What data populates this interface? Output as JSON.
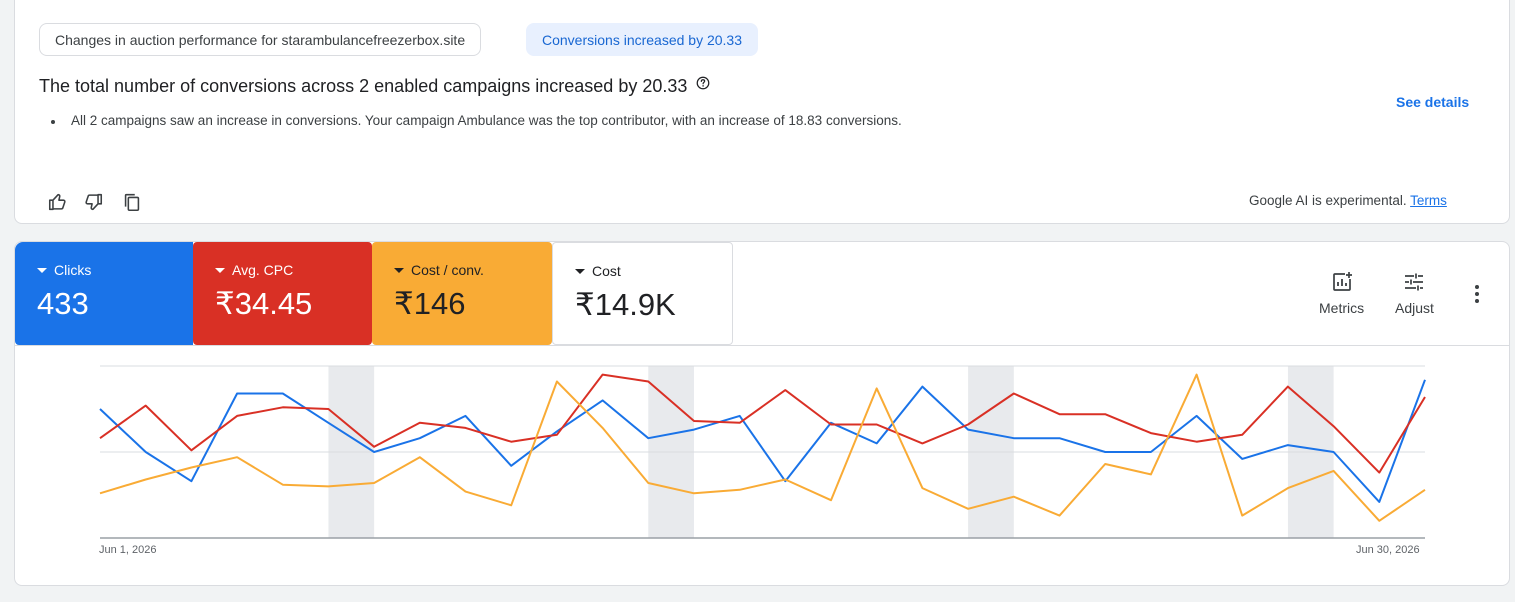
{
  "insight": {
    "chip_auction": "Changes in auction performance for starambulancefreezerbox.site",
    "chip_conversions": "Conversions increased by 20.33",
    "title": "The total number of conversions across 2 enabled campaigns increased by 20.33",
    "bullet": "All 2 campaigns saw an increase in conversions. Your campaign Ambulance was the top contributor, with an increase of 18.83 conversions.",
    "see_details": "See details",
    "ai_note": "Google AI is experimental.",
    "terms": "Terms",
    "icons": [
      "thumb-up-icon",
      "thumb-down-icon",
      "copy-icon",
      "help-icon"
    ]
  },
  "metrics": [
    {
      "label": "Clicks",
      "value": "433",
      "color": "#1a73e8"
    },
    {
      "label": "Avg. CPC",
      "value": "₹34.45",
      "color": "#d93025"
    },
    {
      "label": "Cost / conv.",
      "value": "₹146",
      "color": "#f9ab35"
    },
    {
      "label": "Cost",
      "value": "₹14.9K",
      "color": "#ffffff"
    }
  ],
  "toolbar": {
    "metrics_label": "Metrics",
    "adjust_label": "Adjust",
    "icons": [
      "metrics-add-icon",
      "adjust-sliders-icon",
      "more-vert-icon"
    ]
  },
  "chart_data": {
    "type": "line",
    "x_start": "Jun 1, 2026",
    "x_end": "Jun 30, 2026",
    "days": 30,
    "weekend_bands": [
      [
        6,
        7
      ],
      [
        13,
        14
      ],
      [
        20,
        21
      ],
      [
        27,
        28
      ]
    ],
    "series": [
      {
        "color": "#1a73e8",
        "values": [
          0.75,
          0.5,
          0.33,
          0.84,
          0.84,
          0.67,
          0.5,
          0.58,
          0.71,
          0.42,
          0.62,
          0.8,
          0.58,
          0.63,
          0.71,
          0.33,
          0.67,
          0.55,
          0.88,
          0.63,
          0.58,
          0.58,
          0.5,
          0.5,
          0.71,
          0.46,
          0.54,
          0.5,
          0.21,
          0.92
        ]
      },
      {
        "color": "#d93025",
        "values": [
          0.58,
          0.77,
          0.51,
          0.71,
          0.76,
          0.75,
          0.53,
          0.67,
          0.64,
          0.56,
          0.6,
          0.95,
          0.91,
          0.68,
          0.67,
          0.86,
          0.66,
          0.66,
          0.55,
          0.66,
          0.84,
          0.72,
          0.72,
          0.61,
          0.56,
          0.6,
          0.88,
          0.65,
          0.38,
          0.82
        ]
      },
      {
        "color": "#f9ab35",
        "values": [
          0.26,
          0.34,
          0.41,
          0.47,
          0.31,
          0.3,
          0.32,
          0.47,
          0.27,
          0.19,
          0.91,
          0.64,
          0.32,
          0.26,
          0.28,
          0.34,
          0.22,
          0.87,
          0.29,
          0.17,
          0.24,
          0.13,
          0.43,
          0.37,
          0.95,
          0.13,
          0.29,
          0.39,
          0.1,
          0.28
        ]
      }
    ]
  }
}
